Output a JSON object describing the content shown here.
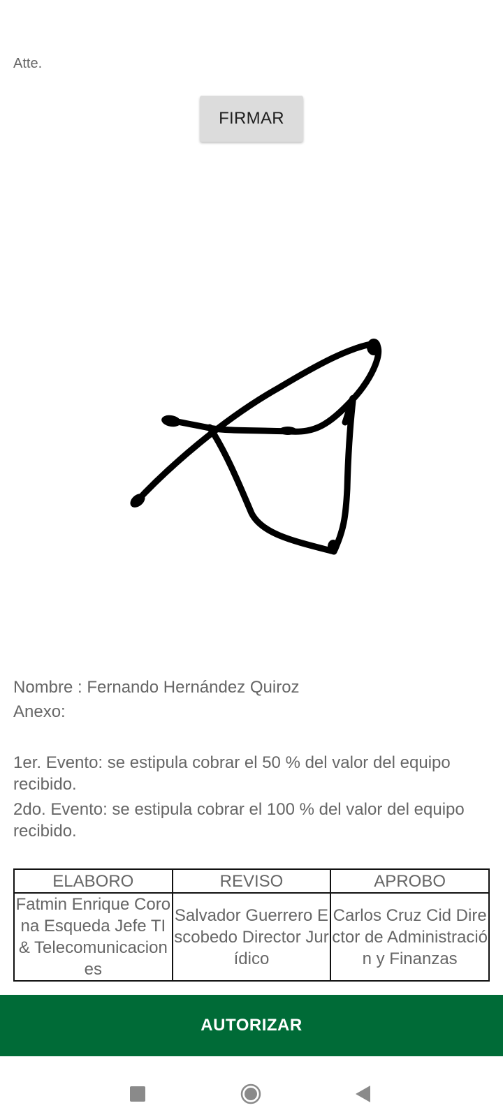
{
  "document": {
    "greeting": "Atte.",
    "sign_button_label": "FIRMAR",
    "name_line": "Nombre : Fernando Hernández Quiroz",
    "annex_label": "Anexo:",
    "events": [
      "1er. Evento: se estipula cobrar el 50 % del valor del equipo recibido.",
      "2do. Evento: se estipula cobrar el 100 % del valor del equipo recibido."
    ]
  },
  "approval_table": {
    "headers": [
      "ELABORO",
      "REVISO",
      "APROBO"
    ],
    "cells": [
      "Fatmin Enrique Corona Esqueda Jefe TI & Telecomunicaciones",
      "Salvador Guerrero Escobedo Director Jurídico",
      "Carlos Cruz Cid Director de Administración y Finanzas"
    ]
  },
  "actions": {
    "authorize_label": "AUTORIZAR"
  },
  "colors": {
    "accent": "#006b37",
    "button_bg": "#dcdcdc"
  },
  "icons": {
    "nav": [
      "recents-square-icon",
      "home-circle-icon",
      "back-triangle-icon"
    ]
  }
}
